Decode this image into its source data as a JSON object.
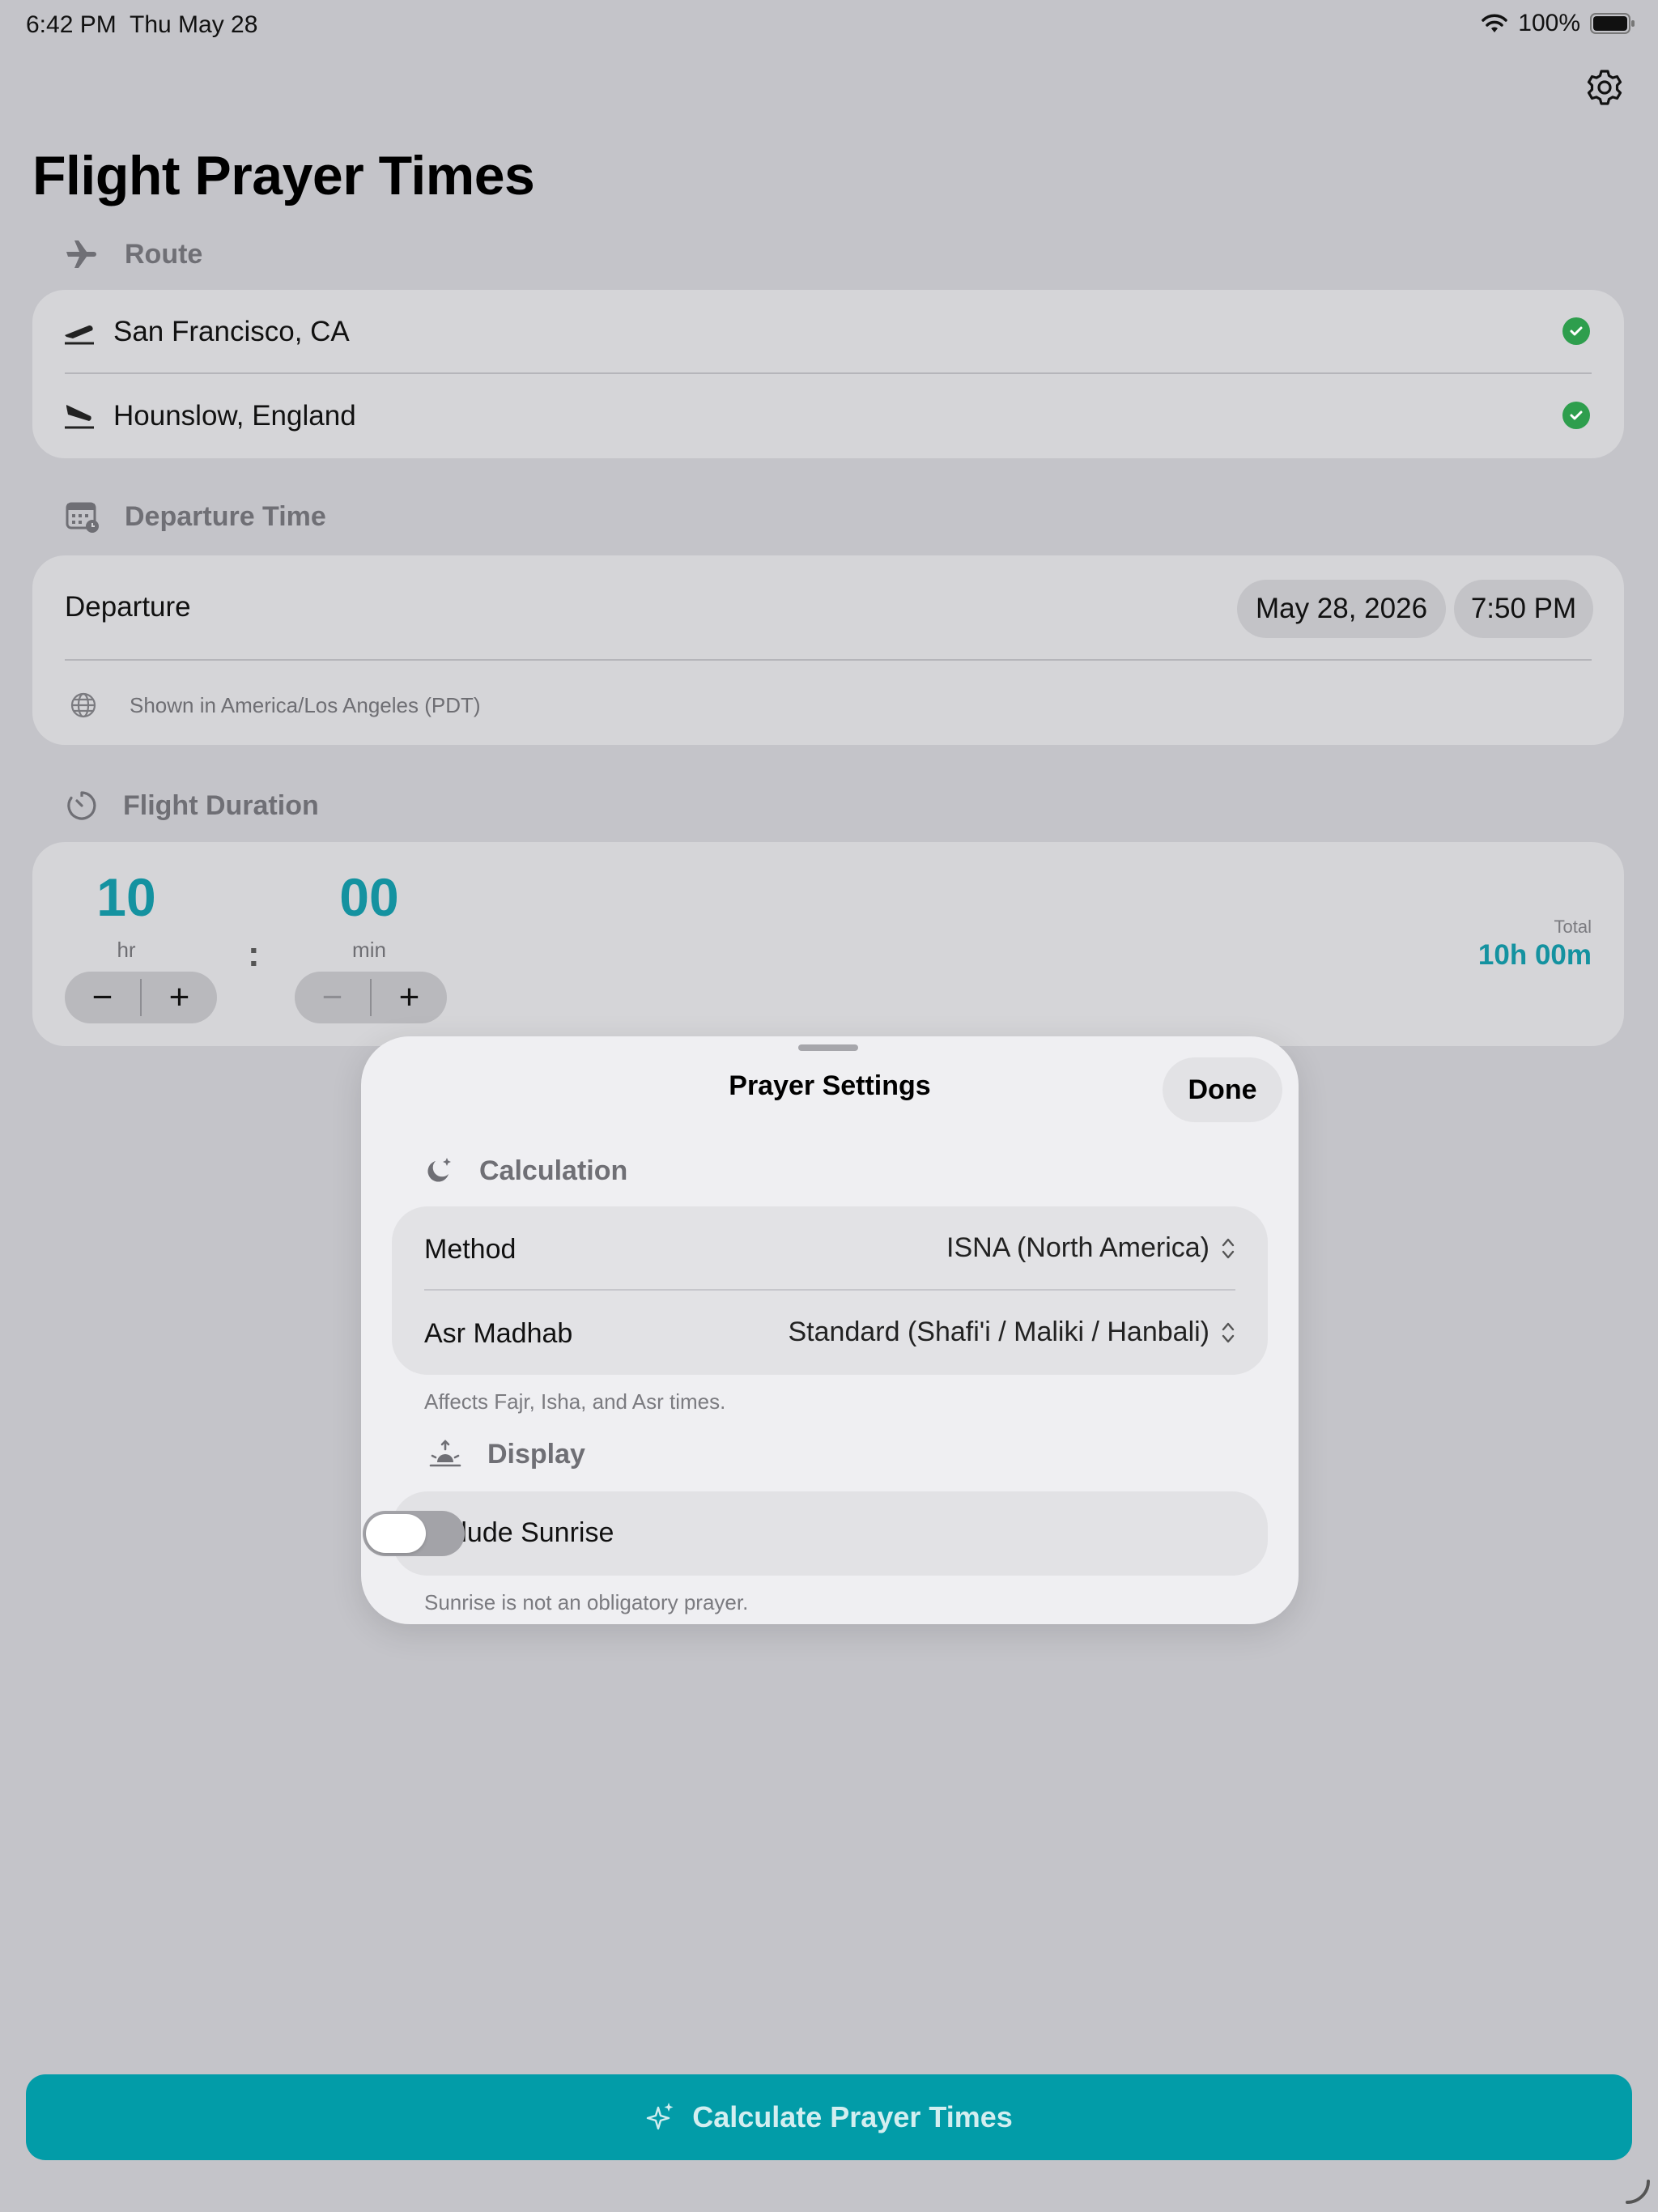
{
  "status_bar": {
    "time": "6:42 PM",
    "date": "Thu May 28",
    "battery": "100%"
  },
  "page_title": "Flight Prayer Times",
  "route": {
    "header": "Route",
    "origin": "San Francisco, CA",
    "destination": "Hounslow, England"
  },
  "departure": {
    "header": "Departure Time",
    "label": "Departure",
    "date": "May 28, 2026",
    "time": "7:50 PM",
    "timezone_note": "Shown in America/Los Angeles (PDT)"
  },
  "duration": {
    "header": "Flight Duration",
    "hours": "10",
    "hours_unit": "hr",
    "minutes": "00",
    "minutes_unit": "min",
    "separator": ":",
    "minus": "−",
    "plus": "+",
    "total_label": "Total",
    "total_value": "10h 00m"
  },
  "sheet": {
    "title": "Prayer Settings",
    "done": "Done",
    "calculation": {
      "header": "Calculation",
      "method_label": "Method",
      "method_value": "ISNA (North America)",
      "madhab_label": "Asr Madhab",
      "madhab_value": "Standard (Shafi'i / Maliki / Hanbali)",
      "footnote": "Affects Fajr, Isha, and Asr times."
    },
    "display": {
      "header": "Display",
      "sunrise_label": "Include Sunrise",
      "sunrise_enabled": false,
      "footnote": "Sunrise is not an obligatory prayer."
    }
  },
  "calculate_button": "Calculate Prayer Times",
  "colors": {
    "accent": "#029ca8",
    "number": "#1492a0",
    "success": "#2e9e4d"
  }
}
